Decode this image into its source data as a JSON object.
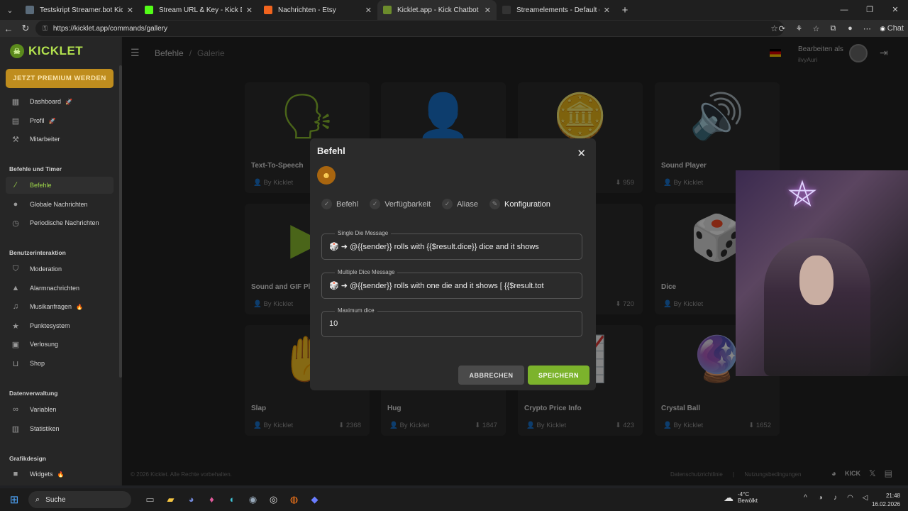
{
  "browser": {
    "tabs": [
      {
        "title": "Testskript Streamer.bot Kick",
        "favicon_color": "#5a6b7a"
      },
      {
        "title": "Stream URL & Key - Kick Dashboa",
        "favicon_color": "#53fc18"
      },
      {
        "title": "Nachrichten - Etsy",
        "favicon_color": "#f1641e"
      },
      {
        "title": "Kicklet.app - Kick Chatbot und",
        "favicon_color": "#6c8c2c"
      },
      {
        "title": "Streamelements - Default comman",
        "favicon_color": "#333333"
      }
    ],
    "active_tab_index": 3,
    "url": "https://kicklet.app/commands/gallery",
    "chat_label": "Chat"
  },
  "sidebar": {
    "brand": "KICKLET",
    "premium_button": "JETZT PREMIUM WERDEN",
    "items_top": [
      {
        "label": "Dashboard",
        "icon": "dashboard-icon",
        "badge": "🚀"
      },
      {
        "label": "Profil",
        "icon": "profile-icon",
        "badge": "🚀"
      },
      {
        "label": "Mitarbeiter",
        "icon": "staff-icon",
        "badge": ""
      }
    ],
    "section1": "Befehle und Timer",
    "items_commands": [
      {
        "label": "Befehle",
        "icon": "wand-icon",
        "active": true
      },
      {
        "label": "Globale Nachrichten",
        "icon": "chat-bubble-icon"
      },
      {
        "label": "Periodische Nachrichten",
        "icon": "clock-icon"
      }
    ],
    "section2": "Benutzerinteraktion",
    "items_interaction": [
      {
        "label": "Moderation",
        "icon": "shield-icon",
        "badge": ""
      },
      {
        "label": "Alarmnachrichten",
        "icon": "warning-icon",
        "badge": ""
      },
      {
        "label": "Musikanfragen",
        "icon": "music-icon",
        "badge": "🔥"
      },
      {
        "label": "Punktesystem",
        "icon": "star-icon",
        "badge": ""
      },
      {
        "label": "Verlosung",
        "icon": "gift-icon",
        "badge": ""
      },
      {
        "label": "Shop",
        "icon": "cart-icon",
        "badge": ""
      }
    ],
    "section3": "Datenverwaltung",
    "items_data": [
      {
        "label": "Variablen",
        "icon": "link-icon"
      },
      {
        "label": "Statistiken",
        "icon": "stats-icon"
      }
    ],
    "section4": "Grafikdesign",
    "items_design": [
      {
        "label": "Widgets",
        "icon": "video-icon",
        "badge": "🔥"
      }
    ]
  },
  "header": {
    "breadcrumb_root": "Befehle",
    "breadcrumb_sep": "/",
    "breadcrumb_current": "Galerie",
    "edit_as_label": "Bearbeiten als",
    "username": "ilvyAuri"
  },
  "gallery": {
    "cards": [
      {
        "title": "Text-To-Speech",
        "author": "By Kicklet",
        "downloads": "",
        "icon": "speaking-head-icon"
      },
      {
        "title": "",
        "author": "",
        "downloads": "",
        "icon": "user-icon"
      },
      {
        "title": "",
        "author": "",
        "downloads": "959",
        "icon": "coin-icon"
      },
      {
        "title": "Sound Player",
        "author": "By Kicklet",
        "downloads": "",
        "icon": "speaker-icon"
      },
      {
        "title": "Sound and GIF Pl",
        "author": "By Kicklet",
        "downloads": "",
        "icon": "play-icon"
      },
      {
        "title": "",
        "author": "",
        "downloads": "",
        "icon": "blank"
      },
      {
        "title": "",
        "author": "",
        "downloads": "720",
        "icon": "money-icon"
      },
      {
        "title": "Dice",
        "author": "By Kicklet",
        "downloads": "",
        "icon": "dice-icon"
      },
      {
        "title": "Slap",
        "author": "By Kicklet",
        "downloads": "2368",
        "icon": "slap-hand-icon"
      },
      {
        "title": "Hug",
        "author": "By Kicklet",
        "downloads": "1847",
        "icon": "hug-icon"
      },
      {
        "title": "Crypto Price Info",
        "author": "By Kicklet",
        "downloads": "423",
        "icon": "chart-up-icon"
      },
      {
        "title": "Crystal Ball",
        "author": "By Kicklet",
        "downloads": "1652",
        "icon": "crystal-ball-icon"
      }
    ]
  },
  "modal": {
    "title": "Befehl",
    "emoji": "☻",
    "steps": [
      "Befehl",
      "Verfügbarkeit",
      "Aliase",
      "Konfiguration"
    ],
    "fields": [
      {
        "label": "Single Die Message",
        "value": "🎲 ➜ @{{sender}} rolls with {{$result.dice}} dice and it shows"
      },
      {
        "label": "Multiple Dice Message",
        "value": "🎲 ➜ @{{sender}} rolls with one die and it shows [ {{$result.tot"
      },
      {
        "label": "Maximum dice",
        "value": "10"
      }
    ],
    "cancel": "ABBRECHEN",
    "save": "SPEICHERN"
  },
  "footer": {
    "copyright": "© 2026 Kicklet. Alle Rechte vorbehalten.",
    "privacy": "Datenschutzrichtlinie",
    "terms": "Nutzungsbedingungen",
    "kick_label": "KICK"
  },
  "taskbar": {
    "search": "Suche",
    "temp": "-4°C",
    "weather": "Bewölkt",
    "time": "21:48",
    "date": "16.02.2026"
  }
}
